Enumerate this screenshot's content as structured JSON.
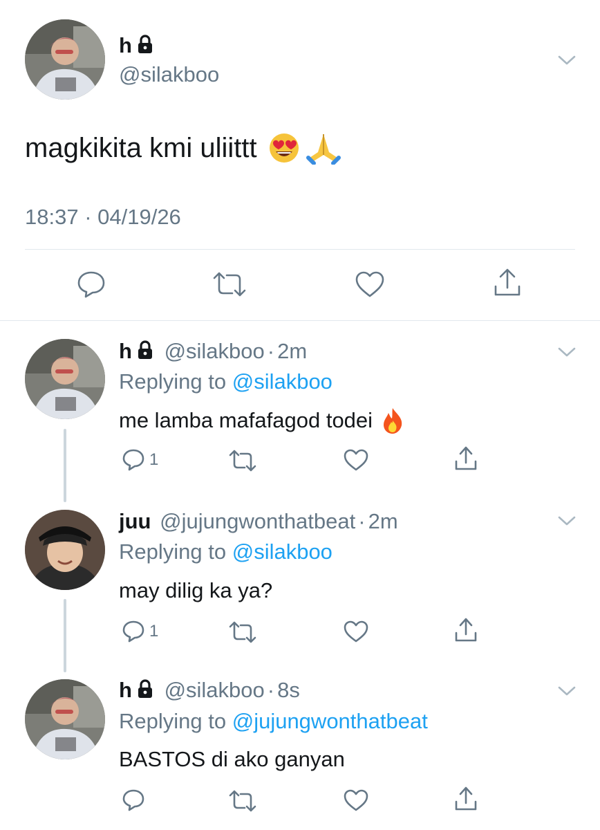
{
  "main_tweet": {
    "display_name": "h",
    "handle": "@silakboo",
    "text": "magkikita kmi uliittt",
    "emojis": [
      "heart-eyes-emoji",
      "folded-hands-emoji"
    ],
    "timestamp": "18:37 · 04/19/26",
    "actions": [
      "reply-icon",
      "retweet-icon",
      "like-icon",
      "share-icon"
    ]
  },
  "replies": [
    {
      "display_name": "h",
      "handle": "@silakboo",
      "time": "2m",
      "replying_label": "Replying to",
      "replying_to": "@silakboo",
      "text": "me lamba mafafagod todei",
      "emoji": "fire-emoji",
      "reply_count": "1"
    },
    {
      "display_name": "juu",
      "handle": "@jujungwonthatbeat",
      "time": "2m",
      "replying_label": "Replying to",
      "replying_to": "@silakboo",
      "text": "may dilig ka ya?",
      "reply_count": "1"
    },
    {
      "display_name": "h",
      "handle": "@silakboo",
      "time": "8s",
      "replying_label": "Replying to",
      "replying_to": "@jujungwonthatbeat",
      "text": "BASTOS di ako ganyan",
      "reply_count": ""
    }
  ],
  "separator": "·",
  "colors": {
    "text": "#14171a",
    "secondary": "#657786",
    "link": "#1da1f2",
    "divider": "#e1e8ed"
  }
}
